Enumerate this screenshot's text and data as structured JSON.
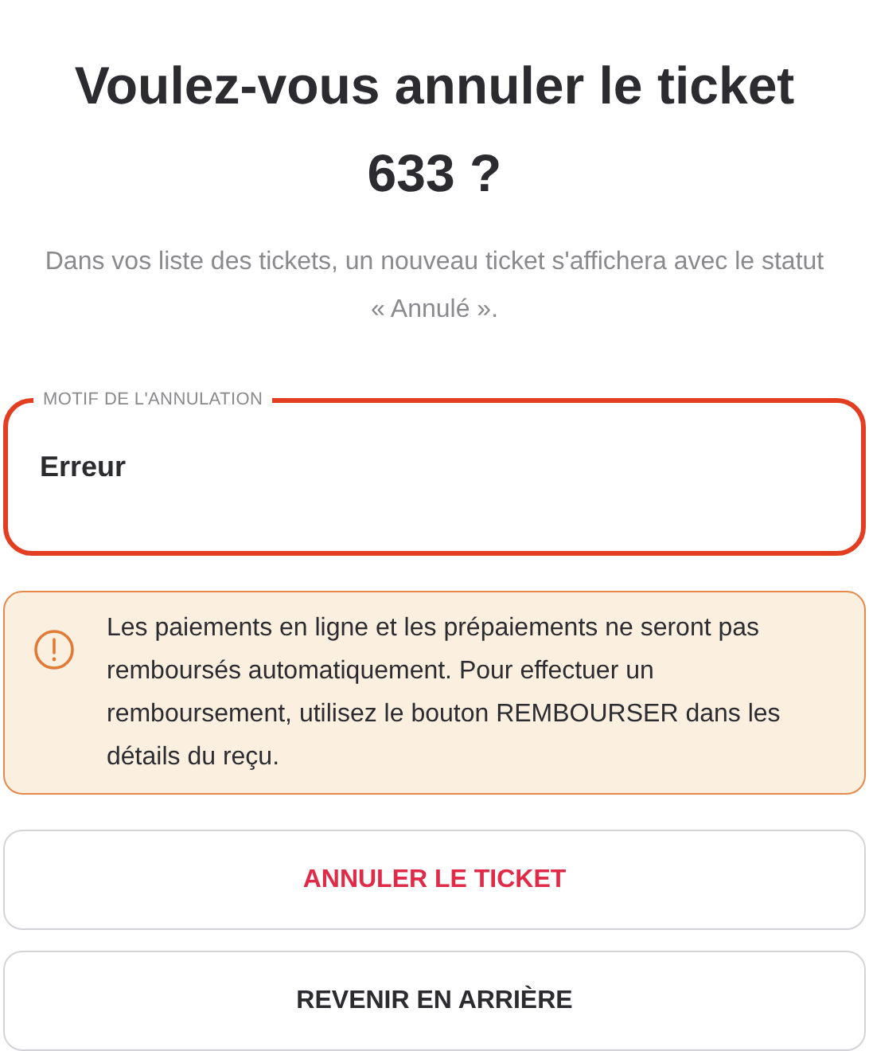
{
  "title": "Voulez-vous annuler le ticket 633 ?",
  "subtitle": "Dans vos liste des tickets, un nouveau ticket s'affichera avec le statut « Annulé ».",
  "reason_field": {
    "label": "MOTIF DE L'ANNULATION",
    "value": "Erreur",
    "focused": true
  },
  "alert": {
    "kind": "warning",
    "text": "Les paiements en ligne et les prépaiements ne seront pas remboursés automatiquement. Pour effectuer un remboursement, utilisez le bouton REMBOURSER dans les détails du reçu."
  },
  "buttons": [
    {
      "label": "ANNULER LE TICKET",
      "kind": "danger"
    },
    {
      "label": "REVENIR EN ARRIÈRE",
      "kind": "default"
    }
  ]
}
